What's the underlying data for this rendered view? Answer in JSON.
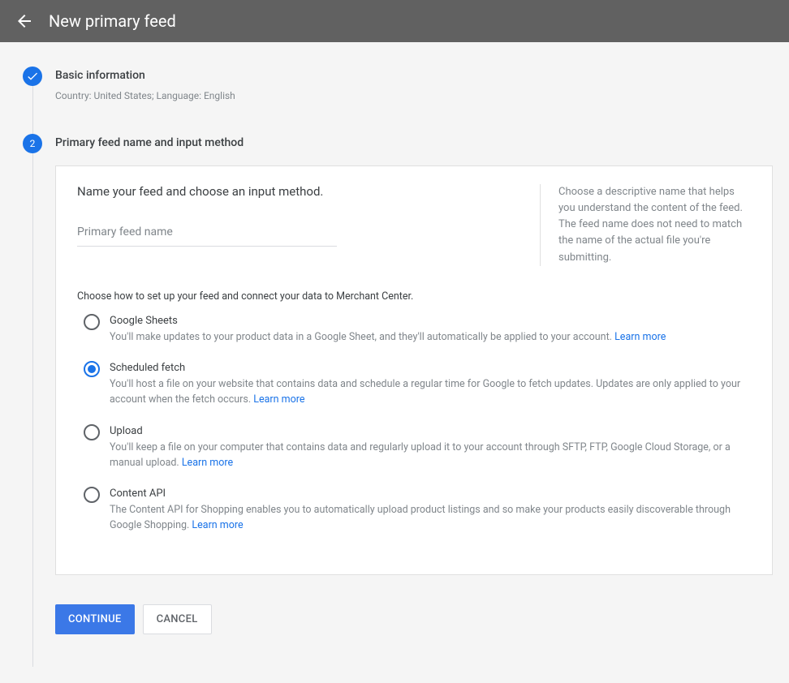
{
  "header": {
    "title": "New primary feed"
  },
  "step1": {
    "title": "Basic information",
    "summary": "Country: United States; Language: English"
  },
  "step2": {
    "number": "2",
    "title": "Primary feed name and input method",
    "card_instruction": "Name your feed and choose an input method.",
    "feed_name_placeholder": "Primary feed name",
    "help_text": "Choose a descriptive name that helps you understand the content of the feed. The feed name does not need to match the name of the actual file you're submitting.",
    "method_intro": "Choose how to set up your feed and connect your data to Merchant Center.",
    "options": {
      "sheets": {
        "label": "Google Sheets",
        "desc": "You'll make updates to your product data in a Google Sheet, and they'll automatically be applied to your account. ",
        "learn_more": "Learn more"
      },
      "fetch": {
        "label": "Scheduled fetch",
        "desc": "You'll host a file on your website that contains data and schedule a regular time for Google to fetch updates. Updates are only applied to your account when the fetch occurs. ",
        "learn_more": "Learn more"
      },
      "upload": {
        "label": "Upload",
        "desc": "You'll keep a file on your computer that contains data and regularly upload it to your account through SFTP, FTP, Google Cloud Storage, or a manual upload. ",
        "learn_more": "Learn more"
      },
      "api": {
        "label": "Content API",
        "desc": "The Content API for Shopping enables you to automatically upload product listings and so make your products easily discoverable through Google Shopping. ",
        "learn_more": "Learn more"
      }
    }
  },
  "actions": {
    "continue": "Continue",
    "cancel": "Cancel"
  }
}
